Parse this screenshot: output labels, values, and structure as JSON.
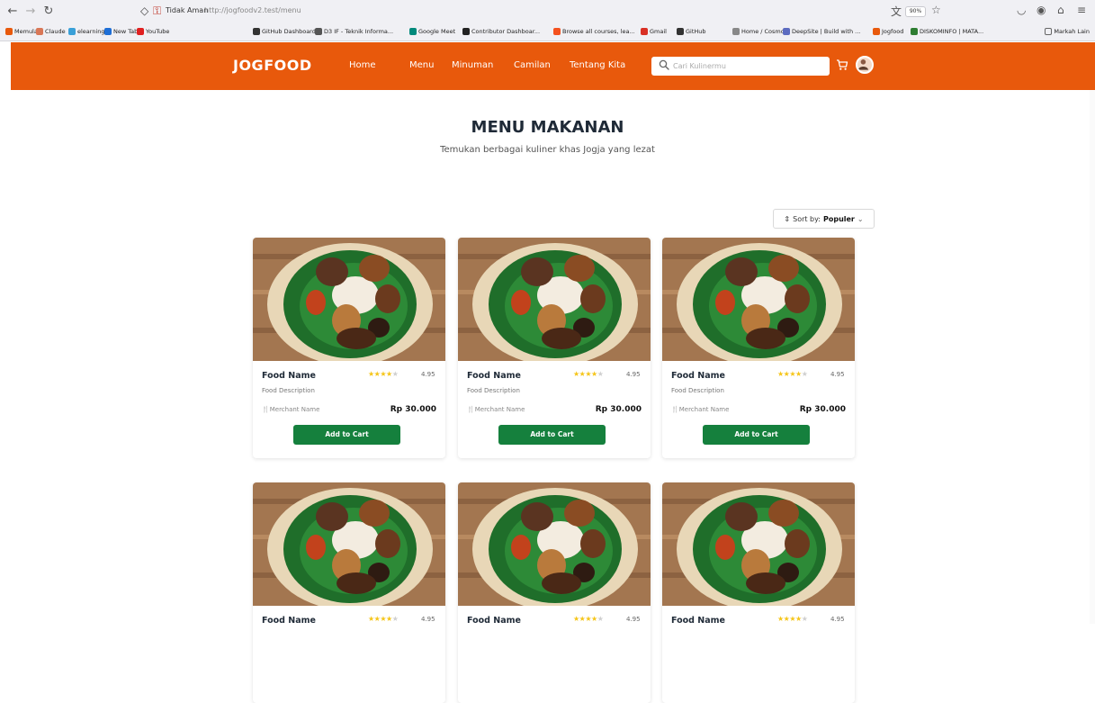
{
  "browser": {
    "security_label": "Tidak Aman",
    "url_host": "http://jogfoodv2.test",
    "url_path": "/menu",
    "zoom": "90%"
  },
  "bookmarks": [
    {
      "label": "Memulai",
      "color": "#e8590c"
    },
    {
      "label": "Claude",
      "color": "#d97757"
    },
    {
      "label": "elearning if",
      "color": "#3aa0d8"
    },
    {
      "label": "New Tab",
      "color": "#1f6fd6"
    },
    {
      "label": "YouTube",
      "color": "#e02020"
    },
    {
      "label": "GitHub Dashboard",
      "color": "#333333"
    },
    {
      "label": "D3 IF - Teknik Informa...",
      "color": "#555555"
    },
    {
      "label": "Google Meet",
      "color": "#00897b"
    },
    {
      "label": "Contributor Dashboar...",
      "color": "#222222"
    },
    {
      "label": "Browse all courses, lea...",
      "color": "#f4511e"
    },
    {
      "label": "Gmail",
      "color": "#d93025"
    },
    {
      "label": "GitHub",
      "color": "#333333"
    },
    {
      "label": "Home / Cosmos",
      "color": "#888888"
    },
    {
      "label": "DeepSite | Build with ...",
      "color": "#5c6bc0"
    },
    {
      "label": "Jogfood",
      "color": "#e8590c"
    },
    {
      "label": "DISKOMINFO | MATA...",
      "color": "#2e7d32"
    },
    {
      "label": "Markah Lain",
      "color": "#666666"
    }
  ],
  "header": {
    "logo": "JOGFOOD",
    "nav": [
      "Home",
      "Menu",
      "Minuman",
      "Camilan",
      "Tentang Kita"
    ],
    "search_placeholder": "Cari Kulinermu"
  },
  "main": {
    "title": "MENU MAKANAN",
    "subtitle": "Temukan berbagai kuliner khas Jogja yang lezat",
    "sort_prefix": "Sort by:",
    "sort_value": "Populer"
  },
  "cards": [
    {
      "name": "Food Name",
      "description": "Food Description",
      "merchant": "Merchant Name",
      "price": "Rp 30.000",
      "rating": "4.95",
      "stars": 4,
      "button": "Add to Cart"
    },
    {
      "name": "Food Name",
      "description": "Food Description",
      "merchant": "Merchant Name",
      "price": "Rp 30.000",
      "rating": "4.95",
      "stars": 4,
      "button": "Add to Cart"
    },
    {
      "name": "Food Name",
      "description": "Food Description",
      "merchant": "Merchant Name",
      "price": "Rp 30.000",
      "rating": "4.95",
      "stars": 4,
      "button": "Add to Cart"
    },
    {
      "name": "Food Name",
      "rating": "4.95",
      "stars": 4
    },
    {
      "name": "Food Name",
      "rating": "4.95",
      "stars": 4
    },
    {
      "name": "Food Name",
      "rating": "4.95",
      "stars": 4
    }
  ],
  "colors": {
    "brand": "#e8590c",
    "button": "#15803d",
    "star": "#f5c518"
  }
}
